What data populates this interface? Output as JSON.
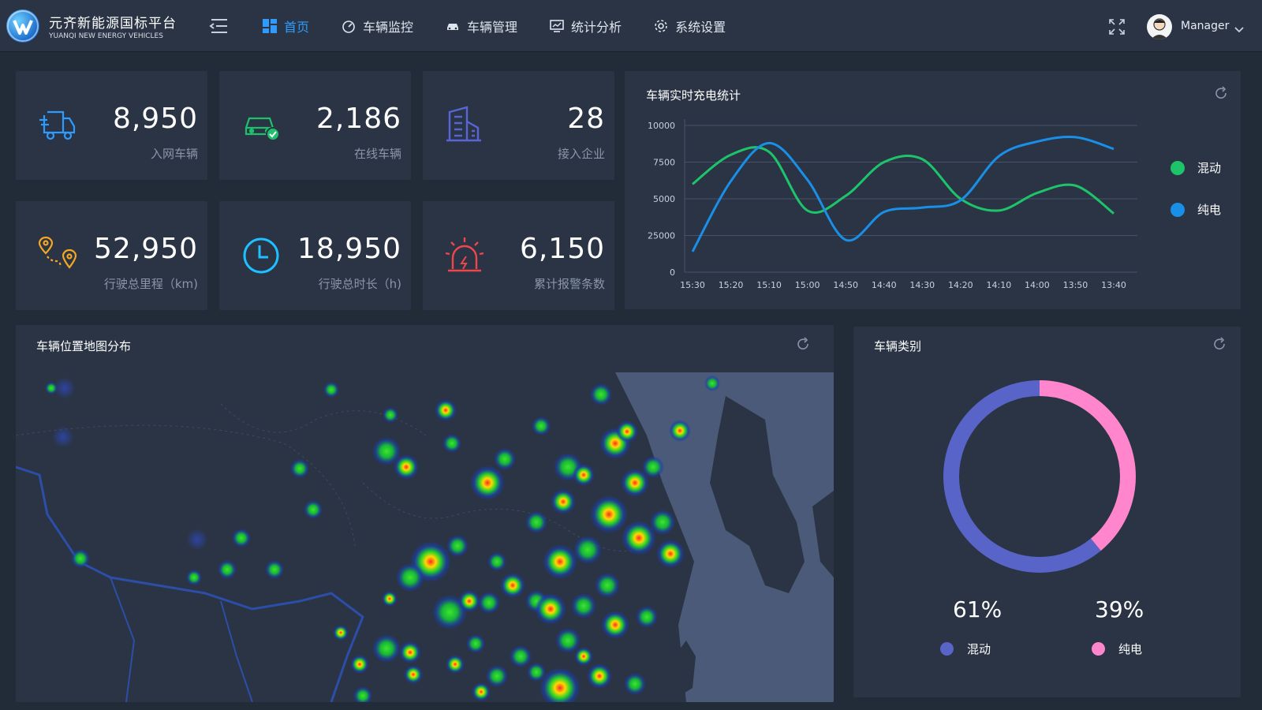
{
  "brand": {
    "title": "元齐新能源国标平台",
    "subtitle": "YUANQI NEW ENERGY VEHICLES"
  },
  "nav": {
    "items": [
      {
        "label": "首页",
        "icon": "dashboard-icon"
      },
      {
        "label": "车辆监控",
        "icon": "speedometer-icon"
      },
      {
        "label": "车辆管理",
        "icon": "car-icon"
      },
      {
        "label": "统计分析",
        "icon": "chart-screen-icon"
      },
      {
        "label": "系统设置",
        "icon": "gear-icon"
      }
    ],
    "active_index": 0
  },
  "user": {
    "name": "Manager"
  },
  "kpis": [
    {
      "value": "8,950",
      "label": "入网车辆",
      "icon": "delivery-truck-icon",
      "color": "#2e9bff"
    },
    {
      "value": "2,186",
      "label": "在线车辆",
      "icon": "car-check-icon",
      "color": "#1fc06c"
    },
    {
      "value": "28",
      "label": "接入企业",
      "icon": "building-icon",
      "color": "#5864d8"
    },
    {
      "value": "52,950",
      "label": "行驶总里程（km)",
      "icon": "route-pins-icon",
      "color": "#f5a623"
    },
    {
      "value": "18,950",
      "label": "行驶总时长（h)",
      "icon": "clock-icon",
      "color": "#1ec0ff"
    },
    {
      "value": "6,150",
      "label": "累计报警条数",
      "icon": "alarm-siren-icon",
      "color": "#f0464b"
    }
  ],
  "charge_panel": {
    "title": "车辆实时充电统计"
  },
  "chart_data": {
    "type": "line",
    "title": "车辆实时充电统计",
    "categories": [
      "15:30",
      "15:20",
      "15:10",
      "15:00",
      "14:50",
      "14:40",
      "14:30",
      "14:20",
      "14:10",
      "14:00",
      "13:50",
      "13:40"
    ],
    "y_ticks": [
      "0",
      "25000",
      "5000",
      "7500",
      "10000"
    ],
    "ylim": [
      0,
      10000
    ],
    "grid": true,
    "legend_position": "right",
    "series": [
      {
        "name": "混动",
        "color": "#1dc46a",
        "values": [
          6000,
          8000,
          8200,
          4200,
          5200,
          7500,
          7700,
          5000,
          4200,
          5400,
          5900,
          4000
        ]
      },
      {
        "name": "纯电",
        "color": "#1a8fe8",
        "values": [
          1400,
          6200,
          8800,
          6300,
          2200,
          4100,
          4400,
          4900,
          7900,
          8900,
          9200,
          8400
        ]
      }
    ]
  },
  "map_panel": {
    "title": "车辆位置地图分布"
  },
  "category_panel": {
    "title": "车辆类别",
    "slices": [
      {
        "name": "混动",
        "percent": 61,
        "label": "61%",
        "color": "#5864c8"
      },
      {
        "name": "纯电",
        "percent": 39,
        "label": "39%",
        "color": "#ff86cc"
      }
    ]
  }
}
